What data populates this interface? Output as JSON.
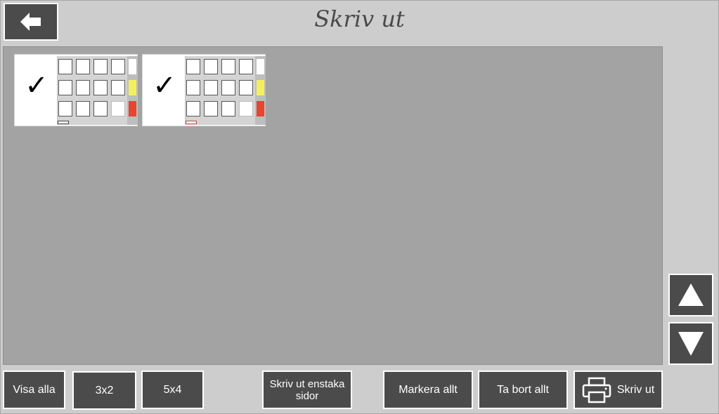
{
  "header": {
    "title": "Skriv ut"
  },
  "toolbar": {
    "show_all": "Visa alla",
    "layout_3x2": "3x2",
    "layout_5x4": "5x4",
    "print_single": "Skriv ut enstaka sidor",
    "select_all": "Markera allt",
    "remove_all": "Ta bort allt",
    "print": "Skriv ut"
  },
  "thumbnails": [
    {
      "checked": true,
      "checkmark": "✓"
    },
    {
      "checked": true,
      "checkmark": "✓"
    }
  ],
  "colors": {
    "button_bg": "#4b4b4b",
    "canvas_bg": "#a3a3a3",
    "page_bg": "#cdcdcd",
    "yellow_cell": "#f5f05a",
    "red_cell": "#e8452e"
  },
  "icons": {
    "back": "arrow-left-icon",
    "up": "triangle-up-icon",
    "down": "triangle-down-icon",
    "printer": "printer-icon"
  }
}
